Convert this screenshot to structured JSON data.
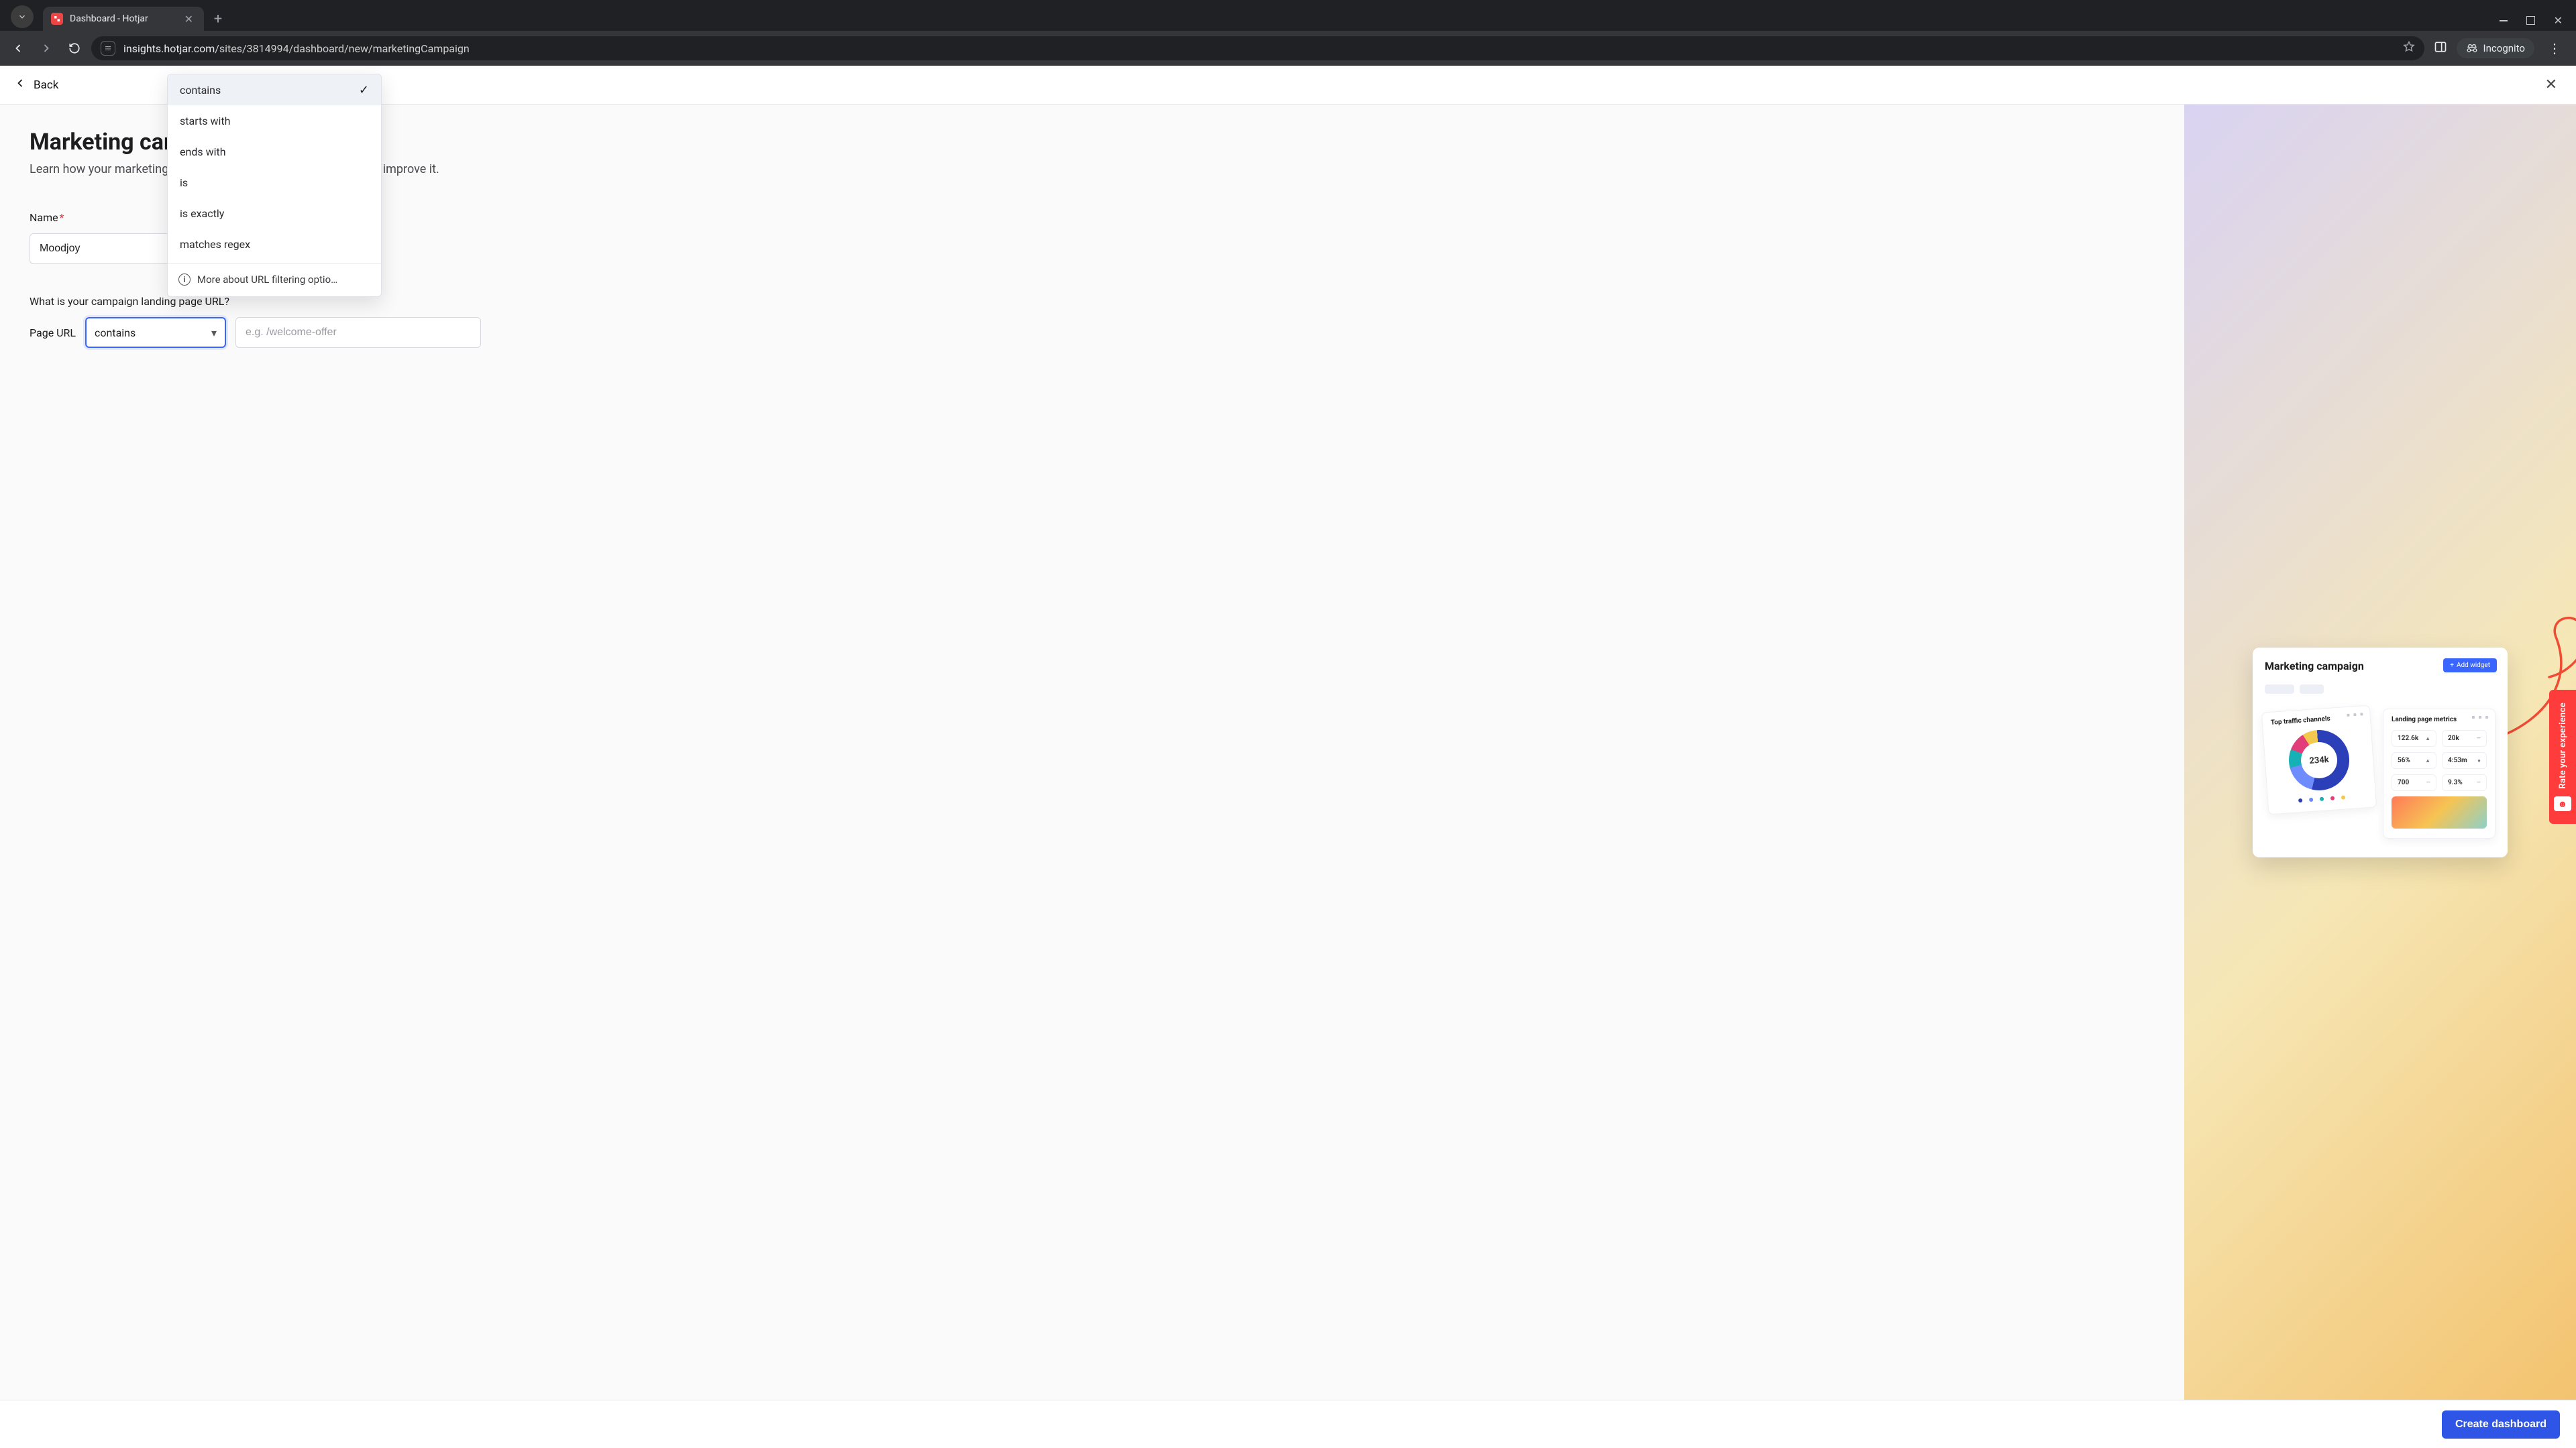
{
  "browser": {
    "tab_title": "Dashboard - Hotjar",
    "url_domain": "insights.hotjar.com",
    "url_path": "/sites/3814994/dashboard/new/marketingCampaign",
    "incognito_label": "Incognito"
  },
  "app_header": {
    "back_label": "Back"
  },
  "page": {
    "title": "Marketing campaign",
    "subtitle_full": "Learn how your marketing landing page is performing, and how to improve it.",
    "name_label": "Name",
    "name_value": "Moodjoy",
    "url_section_label": "What is your campaign landing page URL?",
    "url_field_label": "Page URL",
    "url_select_value": "contains",
    "url_input_placeholder": "e.g. /welcome-offer"
  },
  "dropdown": {
    "options": [
      "contains",
      "starts with",
      "ends with",
      "is",
      "is exactly",
      "matches regex"
    ],
    "selected": "contains",
    "footer_label": "More about URL filtering optio…"
  },
  "preview": {
    "title": "Marketing campaign",
    "add_widget_label": "Add widget",
    "traffic_title": "Top traffic channels",
    "donut_center": "234k",
    "metrics_title": "Landing page metrics",
    "metrics": [
      {
        "val": "122.6k",
        "change": "▲"
      },
      {
        "val": "20k",
        "change": "—"
      },
      {
        "val": "56%",
        "change": "▲"
      },
      {
        "val": "4:53m",
        "change": "●"
      },
      {
        "val": "700",
        "change": "—"
      },
      {
        "val": "9.3%",
        "change": "—"
      }
    ]
  },
  "footer": {
    "create_label": "Create dashboard"
  },
  "feedback": {
    "label": "Rate your experience"
  },
  "colors": {
    "accent": "#2f55e6",
    "danger": "#ff3c3c"
  }
}
